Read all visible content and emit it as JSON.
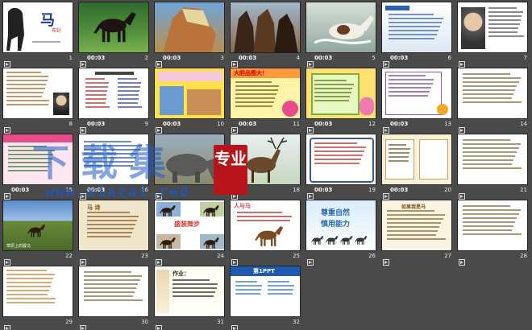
{
  "slides": [
    {
      "number": "1",
      "duration": "",
      "thumb": "title"
    },
    {
      "number": "2",
      "duration": "00:03",
      "thumb": "horse-field"
    },
    {
      "number": "3",
      "duration": "00:03",
      "thumb": "horse-head"
    },
    {
      "number": "4",
      "duration": "00:03",
      "thumb": "horse-herd"
    },
    {
      "number": "5",
      "duration": "00:03",
      "thumb": "horse-water"
    },
    {
      "number": "6",
      "duration": "00:03",
      "thumb": "text-blue"
    },
    {
      "number": "7",
      "duration": "",
      "thumb": "portrait"
    },
    {
      "number": "8",
      "duration": "",
      "thumb": "text-portrait"
    },
    {
      "number": "9",
      "duration": "00:03",
      "thumb": "vocab"
    },
    {
      "number": "10",
      "duration": "00:03",
      "thumb": "yellow-horses"
    },
    {
      "number": "11",
      "duration": "00:03",
      "thumb": "quiz-yellow"
    },
    {
      "number": "12",
      "duration": "00:03",
      "thumb": "quiz-green"
    },
    {
      "number": "13",
      "duration": "00:03",
      "thumb": "table-purple"
    },
    {
      "number": "14",
      "duration": "",
      "thumb": "text-plain"
    },
    {
      "number": "15",
      "duration": "00:03",
      "thumb": "pink-list"
    },
    {
      "number": "16",
      "duration": "00:03",
      "thumb": "blue-text"
    },
    {
      "number": "17",
      "duration": "",
      "thumb": "elephants"
    },
    {
      "number": "18",
      "duration": "",
      "thumb": "deer"
    },
    {
      "number": "19",
      "duration": "00:03",
      "thumb": "frame-text"
    },
    {
      "number": "20",
      "duration": "00:03",
      "thumb": "frame-cards"
    },
    {
      "number": "21",
      "duration": "",
      "thumb": "text-plain2"
    },
    {
      "number": "22",
      "duration": "",
      "thumb": "landscape"
    },
    {
      "number": "23",
      "duration": "",
      "thumb": "poem"
    },
    {
      "number": "24",
      "duration": "",
      "thumb": "dressage"
    },
    {
      "number": "25",
      "duration": "",
      "thumb": "brown-horse"
    },
    {
      "number": "26",
      "duration": "",
      "thumb": "respect"
    },
    {
      "number": "27",
      "duration": "",
      "thumb": "text-beige"
    },
    {
      "number": "28",
      "duration": "",
      "thumb": "text-plain3"
    },
    {
      "number": "29",
      "duration": "",
      "thumb": "text-small"
    },
    {
      "number": "30",
      "duration": "",
      "thumb": "text-plain4"
    },
    {
      "number": "31",
      "duration": "",
      "thumb": "homework"
    },
    {
      "number": "32",
      "duration": "",
      "thumb": "ppt-ad"
    }
  ],
  "texts": {
    "title_char": "马",
    "title_author": "布封",
    "respect_line1": "尊重自然",
    "respect_line2": "慎用能力",
    "horse_title": "人与马",
    "dressage_title": "盛装舞步",
    "homework_title": "作业：",
    "ppt_title": "第1PPT",
    "quiz_title": "大胆品图大！",
    "landscape_caption": "草原上的骏马",
    "page27_title": "如果我是马"
  },
  "watermark": {
    "text": "下载集",
    "url": "www.xiazai.red",
    "seal": "专业"
  },
  "colors": {
    "background": "#4a4a4a",
    "duration_text": "#ffffff",
    "watermark_blue": "#1e5ac8",
    "seal_red": "#b8141c"
  }
}
